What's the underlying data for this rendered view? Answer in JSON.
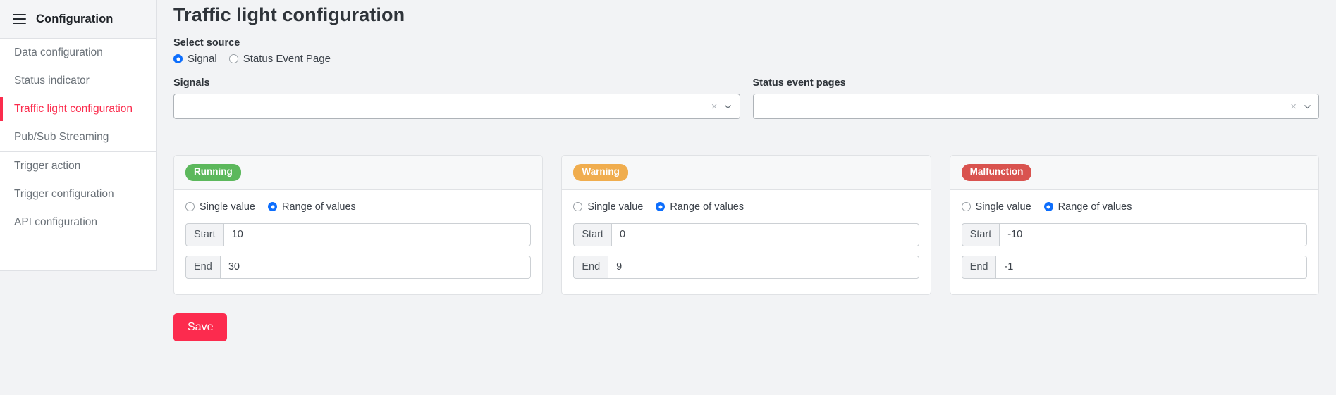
{
  "sidebar": {
    "header_title": "Configuration",
    "menu_icon": "hamburger-icon",
    "groups": [
      {
        "items": [
          {
            "label": "Data configuration",
            "active": false
          },
          {
            "label": "Status indicator",
            "active": false
          },
          {
            "label": "Traffic light configuration",
            "active": true
          },
          {
            "label": "Pub/Sub Streaming",
            "active": false
          }
        ]
      },
      {
        "items": [
          {
            "label": "Trigger action",
            "active": false
          },
          {
            "label": "Trigger configuration",
            "active": false
          },
          {
            "label": "API configuration",
            "active": false
          }
        ]
      }
    ],
    "active_color": "#fb2c4d"
  },
  "main": {
    "page_title": "Traffic light configuration",
    "select_source": {
      "label": "Select source",
      "options": [
        {
          "label": "Signal",
          "checked": true
        },
        {
          "label": "Status Event Page",
          "checked": false
        }
      ]
    },
    "selects": [
      {
        "label": "Signals",
        "value": "",
        "placeholder": "",
        "clear_icon": "close-icon",
        "caret_icon": "chevron-down-icon"
      },
      {
        "label": "Status event pages",
        "value": "",
        "placeholder": "",
        "clear_icon": "close-icon",
        "caret_icon": "chevron-down-icon"
      }
    ],
    "cards": [
      {
        "badge": "Running",
        "badge_color": "#5cb85c",
        "mode_options": [
          {
            "label": "Single value",
            "checked": false
          },
          {
            "label": "Range of values",
            "checked": true
          }
        ],
        "fields": [
          {
            "addon": "Start",
            "value": "10"
          },
          {
            "addon": "End",
            "value": "30"
          }
        ]
      },
      {
        "badge": "Warning",
        "badge_color": "#f0ad4e",
        "mode_options": [
          {
            "label": "Single value",
            "checked": false
          },
          {
            "label": "Range of values",
            "checked": true
          }
        ],
        "fields": [
          {
            "addon": "Start",
            "value": "0"
          },
          {
            "addon": "End",
            "value": "9"
          }
        ]
      },
      {
        "badge": "Malfunction",
        "badge_color": "#d9534f",
        "mode_options": [
          {
            "label": "Single value",
            "checked": false
          },
          {
            "label": "Range of values",
            "checked": true
          }
        ],
        "fields": [
          {
            "addon": "Start",
            "value": "-10"
          },
          {
            "addon": "End",
            "value": "-1"
          }
        ]
      }
    ],
    "save_label": "Save",
    "save_color": "#fc2b4e"
  }
}
